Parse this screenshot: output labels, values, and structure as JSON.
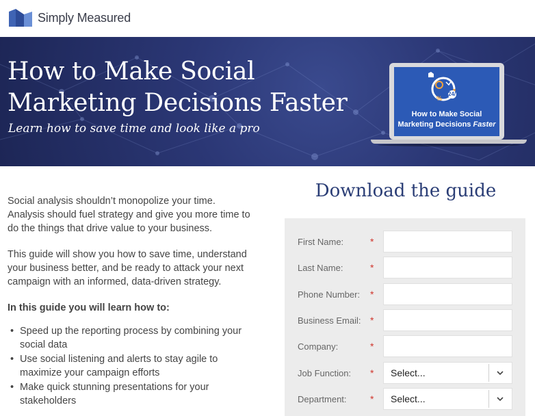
{
  "brand": {
    "name": "Simply Measured",
    "logo_icon": "simply-measured-logo-icon"
  },
  "hero": {
    "title_line1": "How to Make Social",
    "title_line2": "Marketing Decisions Faster",
    "subtitle": "Learn how to save time and look like a pro",
    "ebook_cover": {
      "badge": "24/7",
      "percent": "%",
      "title_line1": "How to Make Social",
      "title_line2a": "Marketing Decisions ",
      "title_line2b": "Faster"
    }
  },
  "body": {
    "para1": "Social analysis shouldn’t monopolize your time. Analysis should fuel strategy and give you more time to do the things that drive value to your business.",
    "para2": "This guide will show you how to save time, understand your business better, and be ready to attack your next campaign with an informed, data-driven strategy.",
    "lead_in": "In this guide you will learn how to:",
    "bullets": [
      "Speed up the reporting process by combining your social data",
      "Use social listening and alerts to stay agile to maximize your campaign efforts",
      "Make quick stunning presentations for your stakeholders"
    ],
    "bullet_glyph": "•"
  },
  "form": {
    "title": "Download the guide",
    "required_marker": "*",
    "fields": [
      {
        "label": "First Name:",
        "value": ""
      },
      {
        "label": "Last Name:",
        "value": ""
      },
      {
        "label": "Phone Number:",
        "value": ""
      },
      {
        "label": "Business Email:",
        "value": ""
      },
      {
        "label": "Company:",
        "value": ""
      }
    ],
    "selects": [
      {
        "label": "Job Function:",
        "selected": "Select..."
      },
      {
        "label": "Department:",
        "selected": "Select..."
      }
    ]
  },
  "colors": {
    "hero_bg": "#2b3775",
    "form_title": "#2b3e76",
    "required": "#d0342c",
    "form_panel": "#ececec"
  }
}
